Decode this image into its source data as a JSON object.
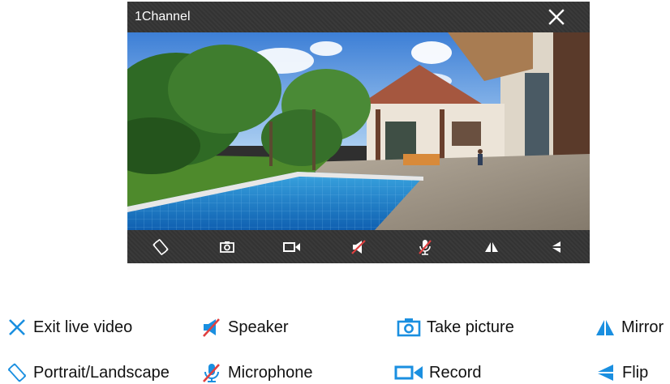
{
  "window": {
    "title": "1Channel"
  },
  "toolbar": {
    "buttons": [
      "rotate-icon",
      "camera-icon",
      "record-icon",
      "speaker-muted-icon",
      "microphone-muted-icon",
      "mirror-icon",
      "flip-icon"
    ]
  },
  "legend": {
    "exit": "Exit live video",
    "speaker": "Speaker",
    "take_picture": "Take picture",
    "mirror": "Mirror",
    "portrait": "Portrait/Landscape",
    "microphone": "Microphone",
    "record": "Record",
    "flip": "Flip"
  },
  "colors": {
    "accent": "#1a8fe0",
    "muted_red": "#e04040",
    "bar": "#333333"
  }
}
